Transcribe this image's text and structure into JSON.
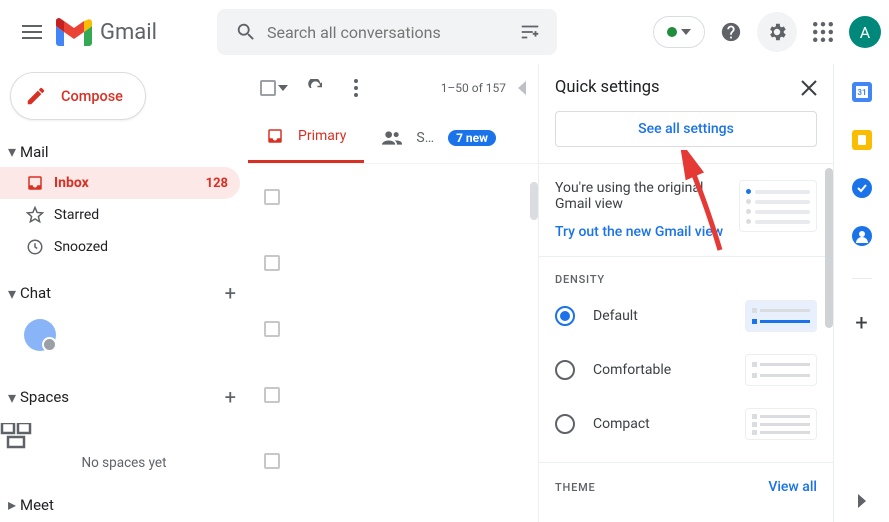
{
  "header": {
    "app_name": "Gmail",
    "search_placeholder": "Search all conversations",
    "avatar_letter": "A"
  },
  "sidebar": {
    "compose_label": "Compose",
    "sections": {
      "mail": "Mail",
      "chat": "Chat",
      "spaces": "Spaces",
      "meet": "Meet"
    },
    "mail_items": [
      {
        "label": "Inbox",
        "count": "128",
        "active": true
      },
      {
        "label": "Starred"
      },
      {
        "label": "Snoozed"
      }
    ],
    "no_spaces": "No spaces yet"
  },
  "toolbar": {
    "pager": "1–50 of 157"
  },
  "tabs": {
    "primary": "Primary",
    "social_short": "S…",
    "badge": "7 new"
  },
  "quick": {
    "title": "Quick settings",
    "see_all": "See all settings",
    "view_using": "You're using the original Gmail view",
    "try_new": "Try out the new Gmail view",
    "density_label": "DENSITY",
    "density": {
      "default": "Default",
      "comfortable": "Comfortable",
      "compact": "Compact"
    },
    "theme_label": "THEME",
    "view_all": "View all"
  }
}
